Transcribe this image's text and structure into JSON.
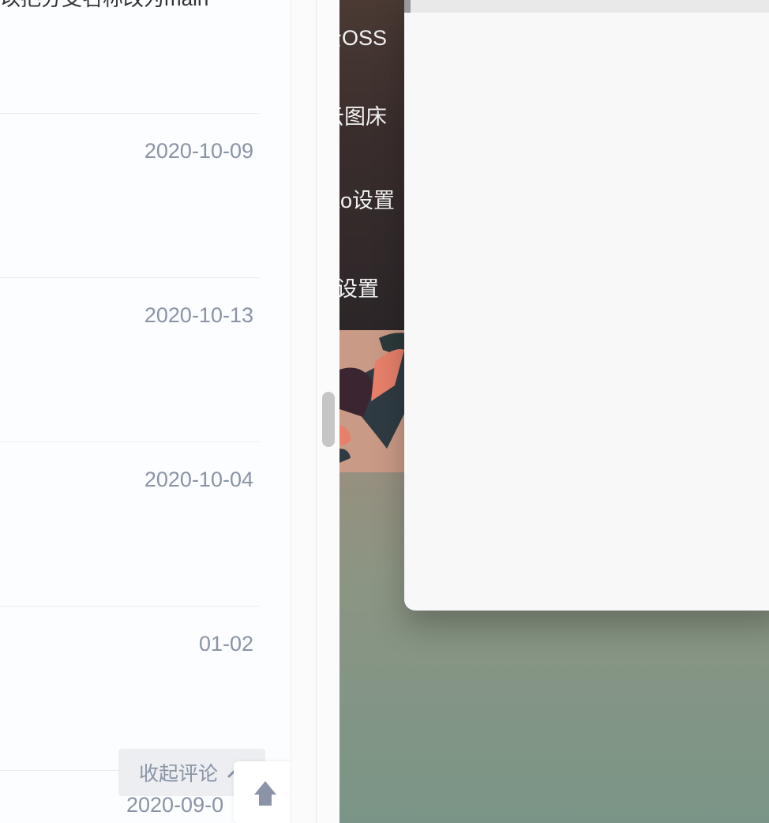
{
  "comments": {
    "top_snippet": "以把分支名称改为main",
    "dates": [
      "2020-10-09",
      "2020-10-13",
      "2020-10-04",
      "01-02"
    ],
    "last_date": "2020-09-0"
  },
  "actions": {
    "collapse_label": "收起评论"
  },
  "desktop_menu": {
    "items": [
      "云OSS",
      "云图床",
      "Hexo设置",
      "设置"
    ]
  }
}
